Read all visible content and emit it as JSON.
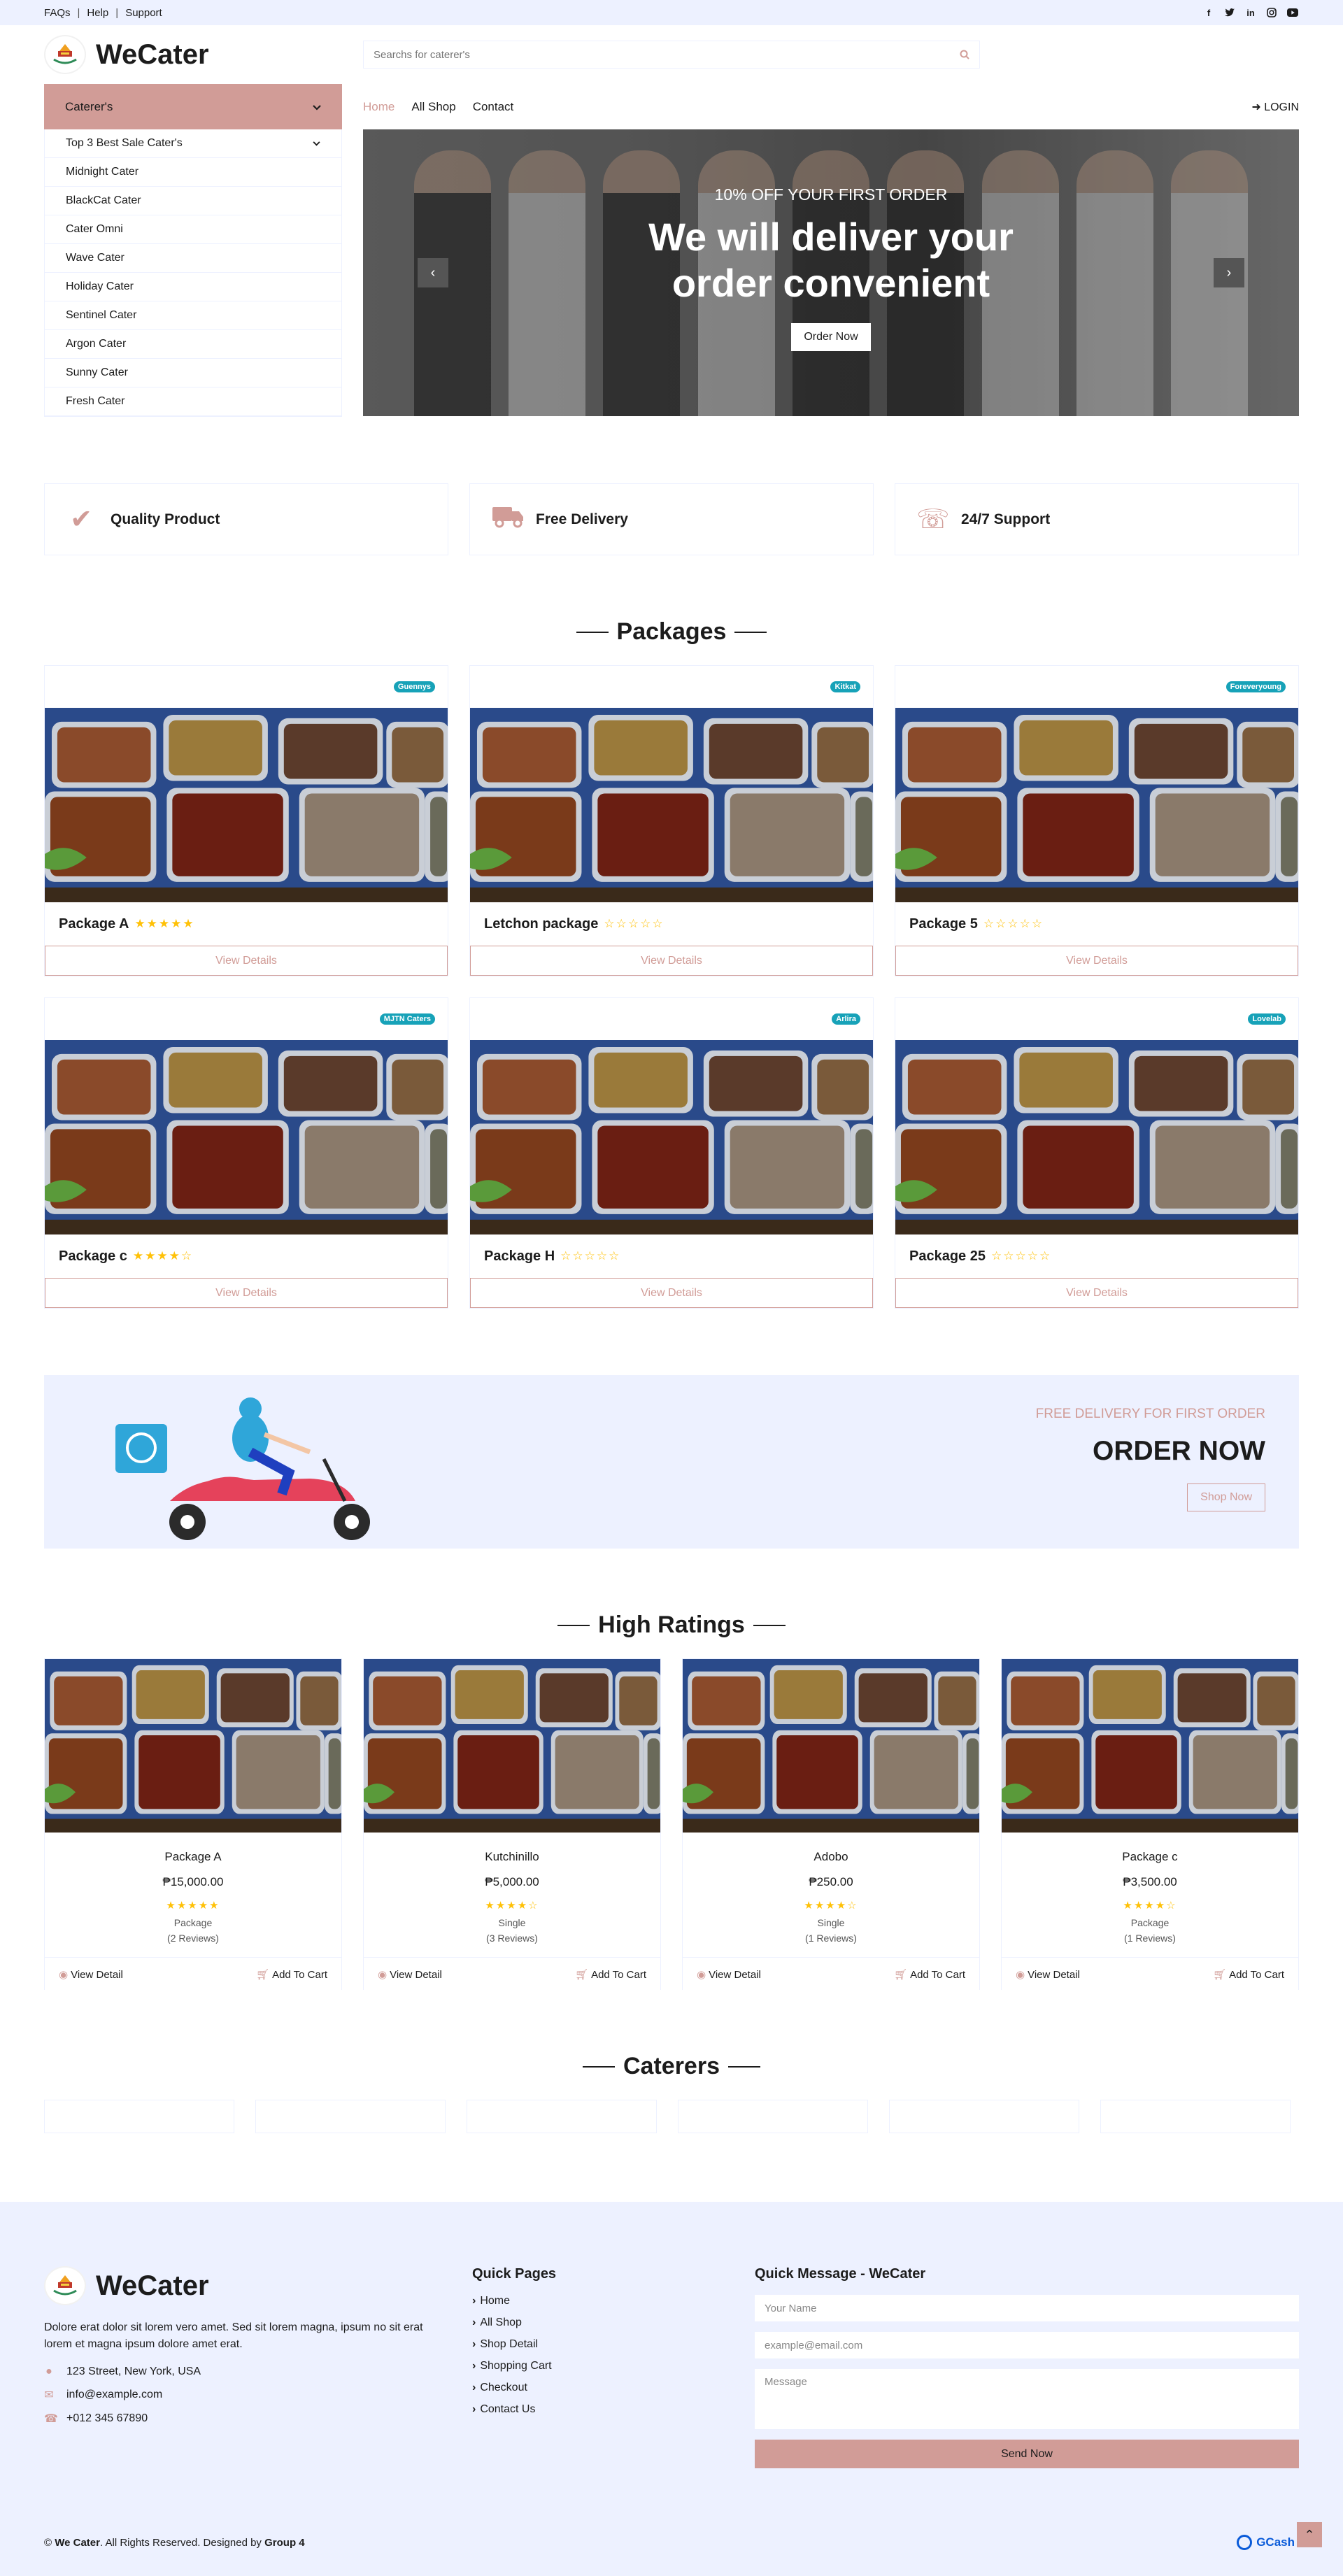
{
  "topbar": {
    "links": [
      "FAQs",
      "Help",
      "Support"
    ],
    "social": [
      "facebook-icon",
      "twitter-icon",
      "linkedin-icon",
      "instagram-icon",
      "youtube-icon"
    ]
  },
  "brand": {
    "name": "WeCater"
  },
  "search": {
    "placeholder": "Searchs for caterer's"
  },
  "sidebar": {
    "header": "Caterer's",
    "items": [
      {
        "label": "Top 3 Best Sale Cater's",
        "has_caret": true
      },
      {
        "label": "Midnight Cater"
      },
      {
        "label": "BlackCat Cater"
      },
      {
        "label": "Cater Omni"
      },
      {
        "label": "Wave Cater"
      },
      {
        "label": "Holiday Cater"
      },
      {
        "label": "Sentinel Cater"
      },
      {
        "label": "Argon Cater"
      },
      {
        "label": "Sunny Cater"
      },
      {
        "label": "Fresh Cater"
      }
    ]
  },
  "nav": {
    "items": [
      "Home",
      "All Shop",
      "Contact"
    ],
    "active": "Home",
    "login": "LOGIN"
  },
  "hero": {
    "subtitle": "10% OFF YOUR FIRST ORDER",
    "title_line1": "We will deliver your",
    "title_line2": "order convenient",
    "button": "Order Now"
  },
  "features": [
    {
      "icon": "check-icon",
      "label": "Quality Product"
    },
    {
      "icon": "truck-icon",
      "label": "Free Delivery"
    },
    {
      "icon": "phone-icon",
      "label": "24/7 Support"
    }
  ],
  "packages": {
    "title": "Packages",
    "button_label": "View Details",
    "items": [
      {
        "name": "Package A",
        "badge": "Guennys",
        "rating": 5
      },
      {
        "name": "Letchon package",
        "badge": "Kitkat",
        "rating": 0
      },
      {
        "name": "Package 5",
        "badge": "Foreveryoung",
        "rating": 0
      },
      {
        "name": "Package c",
        "badge": "MJTN Caters",
        "rating": 4
      },
      {
        "name": "Package H",
        "badge": "Arlira",
        "rating": 0
      },
      {
        "name": "Package 25",
        "badge": "Lovelab",
        "rating": 0
      }
    ]
  },
  "offer": {
    "subtitle": "FREE DELIVERY FOR FIRST ORDER",
    "title": "ORDER NOW",
    "button": "Shop Now"
  },
  "high_ratings": {
    "title": "High Ratings",
    "view_label": "View Detail",
    "cart_label": "Add To Cart",
    "items": [
      {
        "name": "Package A",
        "price": "₱15,000.00",
        "rating": 5,
        "type": "Package",
        "reviews": "(2 Reviews)"
      },
      {
        "name": "Kutchinillo",
        "price": "₱5,000.00",
        "rating": 4,
        "type": "Single",
        "reviews": "(3 Reviews)"
      },
      {
        "name": "Adobo",
        "price": "₱250.00",
        "rating": 4,
        "type": "Single",
        "reviews": "(1 Reviews)"
      },
      {
        "name": "Package c",
        "price": "₱3,500.00",
        "rating": 4,
        "type": "Package",
        "reviews": "(1 Reviews)"
      }
    ]
  },
  "caterers": {
    "title": "Caterers",
    "count": 6
  },
  "footer": {
    "brand": "WeCater",
    "description": "Dolore erat dolor sit lorem vero amet. Sed sit lorem magna, ipsum no sit erat lorem et magna ipsum dolore amet erat.",
    "address": "123 Street, New York, USA",
    "email": "info@example.com",
    "phone": "+012 345 67890",
    "quick_pages_title": "Quick Pages",
    "quick_pages": [
      "Home",
      "All Shop",
      "Shop Detail",
      "Shopping Cart",
      "Checkout",
      "Contact Us"
    ],
    "message_title": "Quick Message - WeCater",
    "name_placeholder": "Your Name",
    "email_placeholder": "example@email.com",
    "message_placeholder": "Message",
    "send_label": "Send Now",
    "copyright_prefix": "©",
    "copyright_brand": "We Cater",
    "copyright_mid": ". All Rights Reserved. Designed by",
    "designer": "Group 4",
    "payment": "GCash"
  },
  "colors": {
    "primary": "#D19C97",
    "secondary": "#EDF1FF",
    "dark": "#1C1C1C",
    "star": "#FFC107",
    "badge": "#17A2B8"
  }
}
